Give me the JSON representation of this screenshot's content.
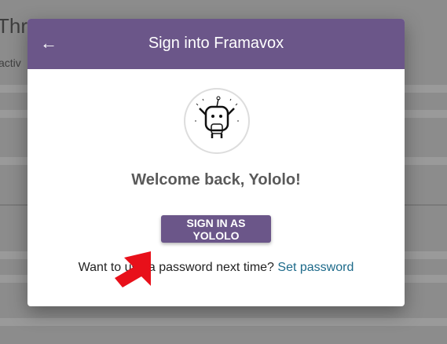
{
  "background": {
    "title": "Thre",
    "subtitle": "activ"
  },
  "dialog": {
    "title": "Sign into Framavox",
    "back_icon": "arrow-left-icon",
    "welcome": "Welcome back, Yololo!",
    "sign_in_button": "SIGN IN AS YOLOLO",
    "password_prompt": "Want to use a password next time?",
    "set_password_link": "Set password"
  },
  "colors": {
    "brand": "#6b5689",
    "link": "#1d6a8a",
    "annotation": "#e8101a"
  }
}
